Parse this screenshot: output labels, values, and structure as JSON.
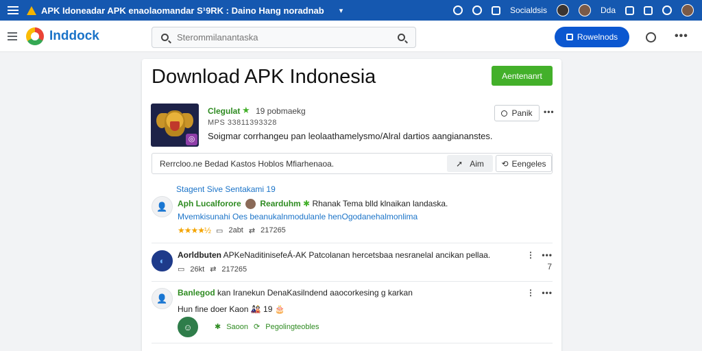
{
  "topbar": {
    "title": "APK Idoneadar APK enaolaomandar S¹9RK : Daino Hang noradnab",
    "right_label": "Socialdsis",
    "right_label2": "Dda"
  },
  "header": {
    "brand": "Inddock",
    "search_placeholder": "Sterommilanantaska",
    "download_label": "Rowelnods"
  },
  "card": {
    "title": "Download APK Indonesia",
    "green_button": "Aentenanrt",
    "app": {
      "name": "Clegulat",
      "downloads": "19 pobmaekg",
      "meta": "MPS 33811393328",
      "description": "Soigmar corrhangeu pan leolaathamelysmo/Alral dartios aangiananstes.",
      "pin_label": "Panik"
    },
    "infobar": {
      "text": "Rerrcloo.ne Bedad Kastos  Hoblos  Mfiarhenaoa.",
      "aim_label": "Aim",
      "tags_label": "Eengeles"
    },
    "section_label": "Stagent Sive Sentakami 19",
    "posts": [
      {
        "author": "Aph Lucalforore",
        "badge": "Rearduhm",
        "text": "Rhanak Tema blld klnaikan landaska.",
        "subline": "Mvemkisunahi Oes beanukalnmodulanle henOgodanehalmonlima",
        "rating": "★★★★½",
        "count1": "2abt",
        "count2": "217265"
      },
      {
        "author": "Aorldbuten",
        "text": "APKeNaditinisefeÁ-AK Patcolanan hercetsbaa nesranelal ancikan pellaa.",
        "count1": "26kt",
        "count2": "217265",
        "side": "7"
      },
      {
        "author": "Banlegod",
        "text": "kan Iranekun DenaKasilndend aaocorkesing g karkan",
        "subline": "Hun fine doer Kaon 🎎 19 🎂",
        "stat1": "Saoon",
        "stat2": "Pegolingteobles"
      }
    ]
  }
}
